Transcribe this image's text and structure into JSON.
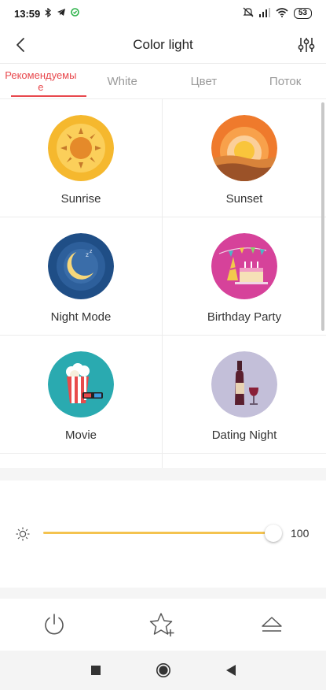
{
  "status_bar": {
    "time": "13:59",
    "icons_left": [
      "bluetooth-icon",
      "telegram-icon",
      "sync-icon"
    ],
    "icons_right": [
      "mute-icon",
      "signal-icon",
      "wifi-icon"
    ],
    "battery": "53"
  },
  "header": {
    "title": "Color light",
    "back_icon": "chevron-left-icon",
    "settings_icon": "sliders-icon"
  },
  "tabs": [
    {
      "label": "Рекомендуемые",
      "active": true
    },
    {
      "label": "White",
      "active": false
    },
    {
      "label": "Цвет",
      "active": false
    },
    {
      "label": "Поток",
      "active": false
    }
  ],
  "scenes": [
    {
      "label": "Sunrise",
      "icon": "sunrise-icon"
    },
    {
      "label": "Sunset",
      "icon": "sunset-icon"
    },
    {
      "label": "Night Mode",
      "icon": "moon-icon"
    },
    {
      "label": "Birthday Party",
      "icon": "cake-icon"
    },
    {
      "label": "Movie",
      "icon": "popcorn-icon"
    },
    {
      "label": "Dating Night",
      "icon": "wine-icon"
    }
  ],
  "brightness": {
    "icon": "brightness-icon",
    "value": "100",
    "level": 1.0,
    "accent": "#f4c34f"
  },
  "actions": [
    {
      "icon": "power-icon"
    },
    {
      "icon": "favorite-add-icon"
    },
    {
      "icon": "eject-icon"
    }
  ],
  "nav": [
    {
      "icon": "recents-icon"
    },
    {
      "icon": "home-icon"
    },
    {
      "icon": "back-icon"
    }
  ],
  "colors": {
    "accent_red": "#e8484d",
    "brightness_yellow": "#f4c34f"
  }
}
